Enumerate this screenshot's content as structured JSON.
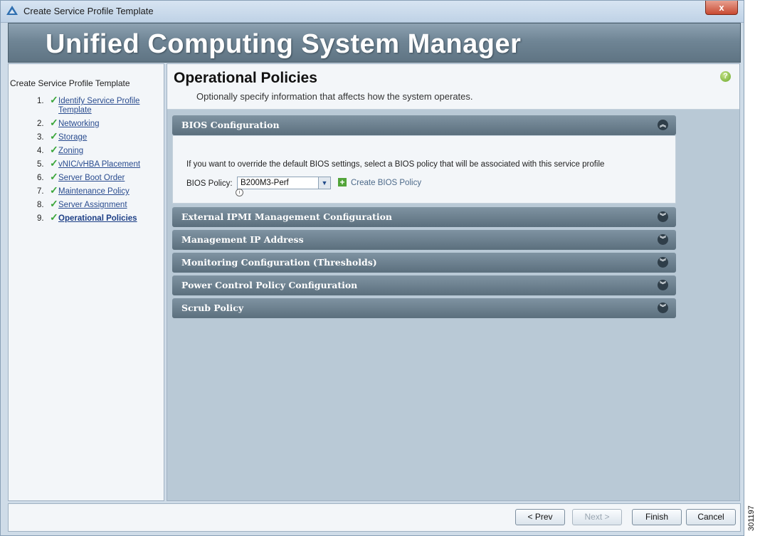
{
  "window": {
    "title": "Create Service Profile Template",
    "close_label": "x"
  },
  "banner": {
    "title": "Unified Computing System Manager"
  },
  "wizard": {
    "title": "Create Service Profile Template",
    "steps": [
      {
        "num": "1.",
        "label": "Identify Service Profile Template"
      },
      {
        "num": "2.",
        "label": "Networking"
      },
      {
        "num": "3.",
        "label": "Storage"
      },
      {
        "num": "4.",
        "label": "Zoning"
      },
      {
        "num": "5.",
        "label": "vNIC/vHBA Placement"
      },
      {
        "num": "6.",
        "label": "Server Boot Order"
      },
      {
        "num": "7.",
        "label": "Maintenance Policy"
      },
      {
        "num": "8.",
        "label": "Server Assignment"
      },
      {
        "num": "9.",
        "label": "Operational Policies"
      }
    ],
    "check_glyph": "✓"
  },
  "page": {
    "title": "Operational Policies",
    "subtitle": "Optionally specify information that affects how the system operates.",
    "help_glyph": "?"
  },
  "bios": {
    "header": "BIOS Configuration",
    "description": "If you want to override the default BIOS settings, select a BIOS policy that will be associated with this service profile",
    "policy_label": "BIOS Policy:",
    "policy_value": "B200M3-Perf",
    "info_glyph": "i",
    "create_label": "Create BIOS Policy"
  },
  "sections": [
    "External IPMI Management Configuration",
    "Management IP Address",
    "Monitoring Configuration (Thresholds)",
    "Power Control Policy Configuration",
    "Scrub Policy"
  ],
  "buttons": {
    "prev": "< Prev",
    "next": "Next >",
    "finish": "Finish",
    "cancel": "Cancel"
  },
  "figure_number": "301197",
  "icons": {
    "collapse": "︽",
    "expand": "︾",
    "plus": "+",
    "dropdown": "▼"
  }
}
